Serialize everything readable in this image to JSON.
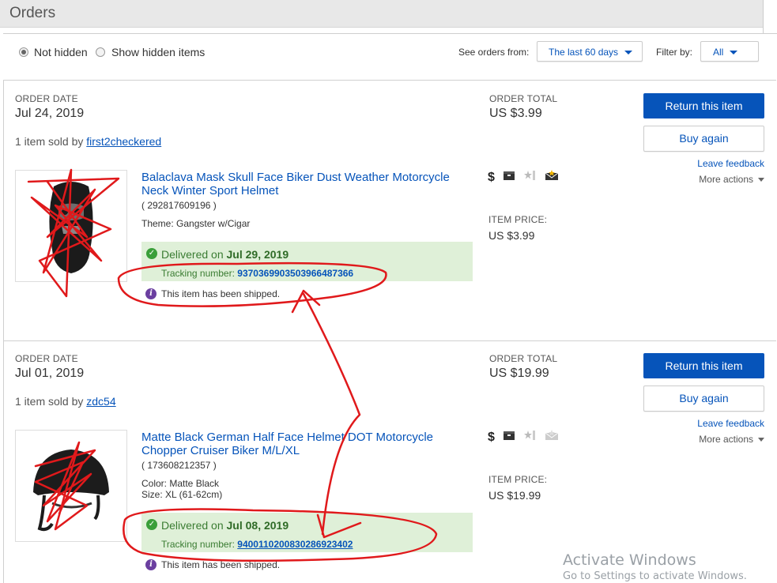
{
  "page": {
    "title": "Orders"
  },
  "filters": {
    "not_hidden": "Not hidden",
    "show_hidden": "Show hidden items",
    "see_orders_from_label": "See orders from:",
    "see_orders_from_value": "The last 60 days",
    "filter_by_label": "Filter by:",
    "filter_by_value": "All"
  },
  "labels": {
    "order_date": "ORDER DATE",
    "order_total": "ORDER TOTAL",
    "item_price": "ITEM PRICE:",
    "return_item": "Return this item",
    "buy_again": "Buy again",
    "leave_feedback": "Leave feedback",
    "more_actions": "More actions",
    "delivered_on": "Delivered on",
    "tracking_number": "Tracking number:",
    "shipped": "This item has been shipped."
  },
  "orders": [
    {
      "date": "Jul 24, 2019",
      "total": "US $3.99",
      "sold_by_prefix": "1 item sold by",
      "seller": "first2checkered",
      "item_title_line1": "Balaclava Mask Skull Face Biker Dust Weather Motorcycle",
      "item_title_line2": "Neck Winter Sport Helmet",
      "item_id": "( 292817609196 )",
      "attr1": "Theme: Gangster w/Cigar",
      "attr2": "",
      "item_price": "US $3.99",
      "delivered_date": "Jul 29, 2019",
      "tracking": "9370369903503966487366"
    },
    {
      "date": "Jul 01, 2019",
      "total": "US $19.99",
      "sold_by_prefix": "1 item sold by",
      "seller": "zdc54",
      "item_title_line1": "Matte Black German Half Face Helmet DOT Motorcycle",
      "item_title_line2": "Chopper Cruiser Biker M/L/XL",
      "item_id": "( 173608212357 )",
      "attr1": "Color: Matte Black",
      "attr2": "Size: XL (61-62cm)",
      "item_price": "US $19.99",
      "delivered_date": "Jul 08, 2019",
      "tracking": "9400110200830286923402"
    }
  ],
  "icons": [
    "dollar-icon",
    "package-icon",
    "star-feedback-icon",
    "envelope-star-icon"
  ],
  "colors": {
    "link": "#0654ba",
    "primary_button": "#0654ba",
    "delivered_bg": "#dff0d8",
    "annotation_red": "#e0191b"
  },
  "watermark": {
    "line1": "Activate Windows",
    "line2": "Go to Settings to activate Windows."
  }
}
